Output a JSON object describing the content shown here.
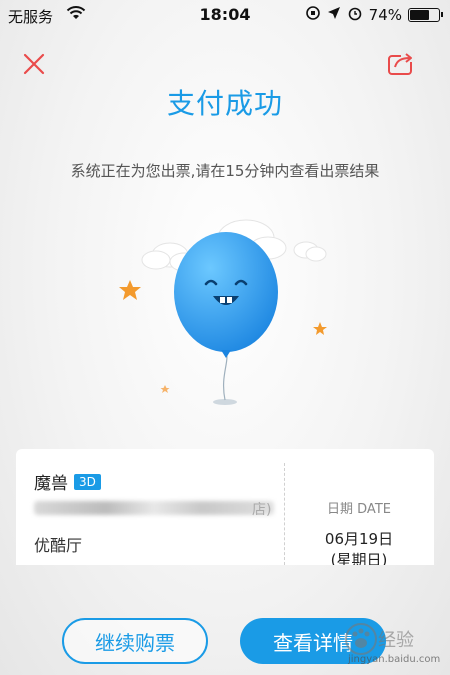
{
  "status_bar": {
    "carrier": "无服务",
    "time": "18:04",
    "battery_text": "74%",
    "battery_level": 0.74
  },
  "header": {
    "close_icon": "close-icon",
    "share_icon": "share-icon"
  },
  "main": {
    "title": "支付成功",
    "subtitle": "系统正在为您出票,请在15分钟内查看出票结果"
  },
  "ticket": {
    "movie_title": "魔兽",
    "format_badge": "3D",
    "cinema_name_blurred": "店)",
    "hall": "优酷厅",
    "date_label": "日期 DATE",
    "date_value": "06月19日",
    "weekday": "(星期日)"
  },
  "actions": {
    "continue_label": "继续购票",
    "detail_label": "查看详情"
  },
  "watermark": {
    "name": "经验",
    "url": "jingyan.baidu.com"
  },
  "colors": {
    "accent": "#1a9be6",
    "close": "#e94b4b",
    "star": "#f39a2d"
  }
}
